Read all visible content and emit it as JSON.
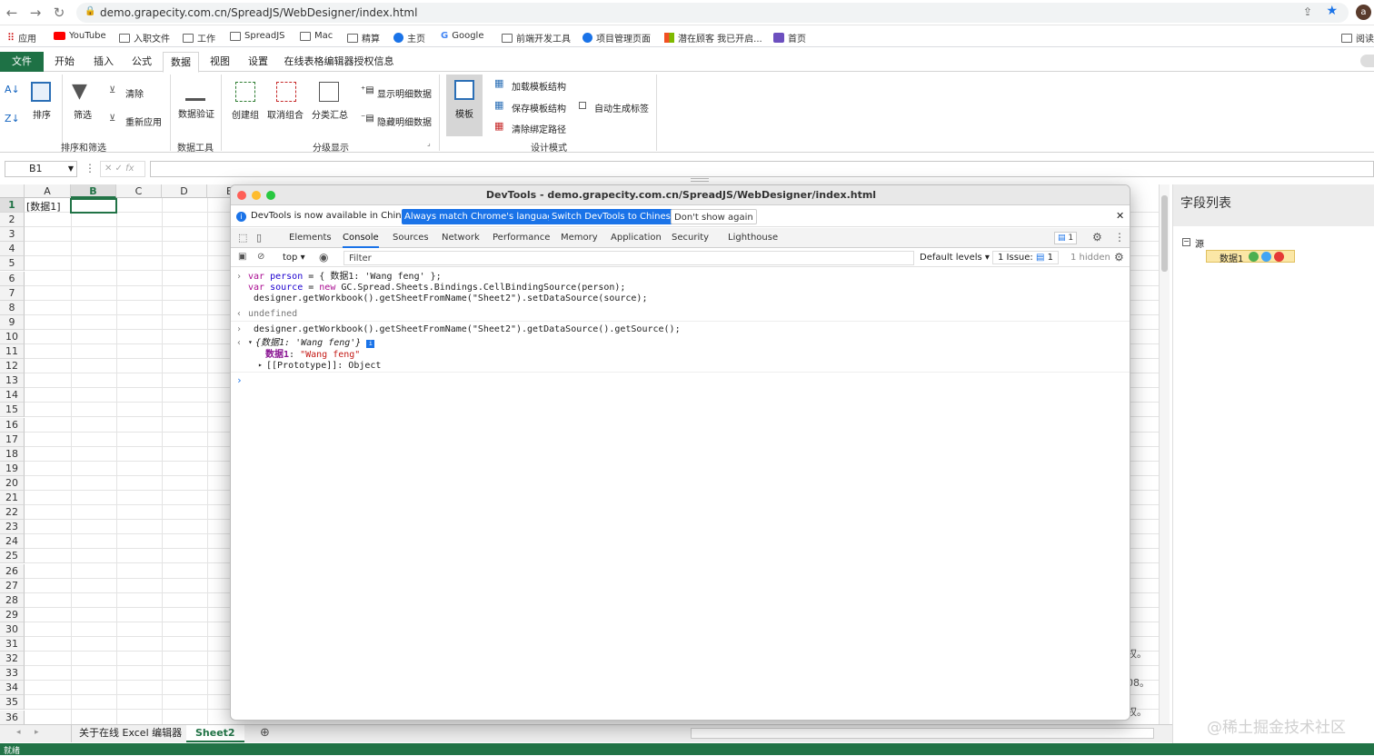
{
  "browser": {
    "url": "demo.grapecity.com.cn/SpreadJS/WebDesigner/index.html",
    "avatar": "a"
  },
  "bookmarks": [
    "应用",
    "YouTube",
    "入职文件",
    "工作",
    "SpreadJS",
    "Mac",
    "精算",
    "主页",
    "Google",
    "前端开发工具",
    "项目管理页面",
    "潜在顾客 我已开启...",
    "首页"
  ],
  "reading_list": "阅读",
  "ribbon_tabs": [
    "文件",
    "开始",
    "插入",
    "公式",
    "数据",
    "视图",
    "设置",
    "在线表格编辑器授权信息"
  ],
  "ribbon": {
    "sort": "排序",
    "filter": "筛选",
    "clear": "清除",
    "reapply": "重新应用",
    "validation": "数据验证",
    "group": "创建组",
    "ungroup": "取消组合",
    "subtotal": "分类汇总",
    "show_detail": "显示明细数据",
    "hide_detail": "隐藏明细数据",
    "template": "模板",
    "load_schema": "加载模板结构",
    "save_schema": "保存模板结构",
    "clear_path": "清除绑定路径",
    "auto_label": "自动生成标签",
    "grp_sort": "排序和筛选",
    "grp_tools": "数据工具",
    "grp_outline": "分级显示",
    "grp_design": "设计模式"
  },
  "formula": {
    "cell": "B1",
    "fx": "fx"
  },
  "grid": {
    "columns": [
      "A",
      "B",
      "C",
      "D",
      "E"
    ],
    "rows": [
      "1",
      "2",
      "3",
      "4",
      "5",
      "6",
      "7",
      "8",
      "9",
      "10",
      "11",
      "12",
      "13",
      "14",
      "15",
      "16",
      "17",
      "18",
      "19",
      "20",
      "21",
      "22",
      "23",
      "24",
      "25",
      "26",
      "27",
      "28",
      "29",
      "30",
      "31",
      "32",
      "33",
      "34",
      "35",
      "36"
    ],
    "a1": "[数据1]",
    "edge_text": [
      "权。",
      "08。",
      "权。"
    ]
  },
  "sheets": [
    "关于在线 Excel 编辑器",
    "Sheet2"
  ],
  "status": "就绪",
  "panel": {
    "title": "字段列表",
    "root": "源",
    "field": "数据1"
  },
  "devtools": {
    "title": "DevTools - demo.grapecity.com.cn/SpreadJS/WebDesigner/index.html",
    "info": "DevTools is now available in Chinese!",
    "btn1": "Always match Chrome's language",
    "btn2": "Switch DevTools to Chinese",
    "btn3": "Don't show again",
    "tabs": [
      "Elements",
      "Console",
      "Sources",
      "Network",
      "Performance",
      "Memory",
      "Application",
      "Security",
      "Lighthouse"
    ],
    "msg_count": "1",
    "context": "top",
    "filter": "Filter",
    "levels": "Default levels ▾",
    "issue_label": "1 Issue:",
    "issue_count": "1",
    "hidden": "1 hidden",
    "lines": {
      "l1": "{ 数据1: 'Wang feng' };",
      "l2": "GC.Spread.Sheets.Bindings.CellBindingSource(person);",
      "l3": "designer.getWorkbook().getSheetFromName(\"Sheet2\").setDataSource(source);",
      "l4": "undefined",
      "l5": "designer.getWorkbook().getSheetFromName(\"Sheet2\").getDataSource().getSource();",
      "l6": "{数据1: 'Wang feng'}",
      "l7k": "数据1",
      "l7v": "\"Wang feng\"",
      "l8": "[[Prototype]]: Object"
    }
  },
  "watermark": "@稀土掘金技术社区",
  "colors": {
    "accent": "#217346",
    "devtools_blue": "#1a73e8"
  }
}
